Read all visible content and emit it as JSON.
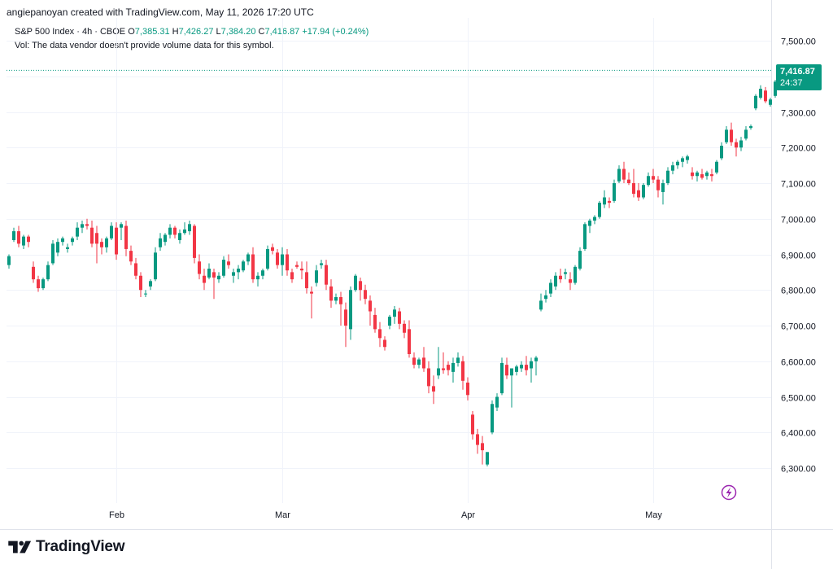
{
  "header": {
    "credit": "angiepanoyan created with TradingView.com, May 11, 2026 17:20 UTC",
    "symbol": "S&P 500 Index · 4h · CBOE",
    "open_label": "O",
    "open": "7,385.31",
    "high_label": "H",
    "high": "7,426.27",
    "low_label": "L",
    "low": "7,384.20",
    "close_label": "C",
    "close": "7,416.87",
    "change": "+17.94 (+0.24%)",
    "volume_note": "Vol: The data vendor doesn't provide volume data for this symbol."
  },
  "price_tag": {
    "price": "7,416.87",
    "countdown": "24:37"
  },
  "brand": {
    "name": "TradingView"
  },
  "icons": {
    "logo": "tradingview-logo-icon",
    "replay": "lightning-icon"
  },
  "colors": {
    "up": "#089981",
    "down": "#f23645",
    "grid": "#f0f3fa",
    "text": "#131722",
    "last_line": "#089981",
    "replay": "#9c27b0"
  },
  "chart_data": {
    "type": "candlestick",
    "title": "S&P 500 Index · 4h · CBOE",
    "ylim": [
      6200,
      7540
    ],
    "yticks": [
      6300,
      6400,
      6500,
      6600,
      6700,
      6800,
      6900,
      7000,
      7100,
      7200,
      7300,
      7400,
      7500
    ],
    "ytick_labels": [
      "6,300.00",
      "6,400.00",
      "6,500.00",
      "6,600.00",
      "6,700.00",
      "6,800.00",
      "6,900.00",
      "7,000.00",
      "7,100.00",
      "7,200.00",
      "7,300.00",
      "7,400.00",
      "7,500.00"
    ],
    "xticks": [
      {
        "label": "Feb",
        "index": 22
      },
      {
        "label": "Mar",
        "index": 56
      },
      {
        "label": "Apr",
        "index": 94
      },
      {
        "label": "May",
        "index": 132
      }
    ],
    "last_price": 7416.87,
    "grid": true,
    "candles": [
      [
        6870,
        6900,
        6860,
        6895
      ],
      [
        6940,
        6975,
        6935,
        6965
      ],
      [
        6965,
        6980,
        6920,
        6930
      ],
      [
        6925,
        6955,
        6915,
        6950
      ],
      [
        6950,
        6955,
        6920,
        6935
      ],
      [
        6865,
        6880,
        6820,
        6830
      ],
      [
        6830,
        6840,
        6795,
        6805
      ],
      [
        6805,
        6835,
        6800,
        6830
      ],
      [
        6830,
        6880,
        6825,
        6870
      ],
      [
        6875,
        6940,
        6870,
        6930
      ],
      [
        6905,
        6945,
        6895,
        6935
      ],
      [
        6935,
        6950,
        6925,
        6945
      ],
      [
        6915,
        6930,
        6905,
        6920
      ],
      [
        6935,
        6950,
        6925,
        6945
      ],
      [
        6950,
        6990,
        6940,
        6975
      ],
      [
        6975,
        6995,
        6960,
        6985
      ],
      [
        6985,
        7000,
        6970,
        6980
      ],
      [
        6975,
        6995,
        6920,
        6930
      ],
      [
        6960,
        6980,
        6875,
        6930
      ],
      [
        6935,
        6945,
        6900,
        6920
      ],
      [
        6920,
        6950,
        6905,
        6945
      ],
      [
        6945,
        6990,
        6940,
        6980
      ],
      [
        6975,
        6990,
        6885,
        6900
      ],
      [
        6975,
        6990,
        6940,
        6985
      ],
      [
        6980,
        6995,
        6895,
        6915
      ],
      [
        6910,
        6925,
        6870,
        6880
      ],
      [
        6875,
        6890,
        6830,
        6840
      ],
      [
        6840,
        6850,
        6780,
        6800
      ],
      [
        6790,
        6800,
        6780,
        6790
      ],
      [
        6810,
        6830,
        6800,
        6825
      ],
      [
        6830,
        6920,
        6825,
        6905
      ],
      [
        6920,
        6960,
        6910,
        6945
      ],
      [
        6935,
        6960,
        6925,
        6955
      ],
      [
        6955,
        6985,
        6945,
        6975
      ],
      [
        6975,
        6980,
        6945,
        6955
      ],
      [
        6940,
        6970,
        6930,
        6960
      ],
      [
        6960,
        6990,
        6955,
        6970
      ],
      [
        6965,
        6995,
        6955,
        6985
      ],
      [
        6980,
        6985,
        6875,
        6890
      ],
      [
        6880,
        6900,
        6830,
        6845
      ],
      [
        6840,
        6860,
        6800,
        6820
      ],
      [
        6835,
        6875,
        6830,
        6860
      ],
      [
        6850,
        6860,
        6775,
        6835
      ],
      [
        6830,
        6850,
        6820,
        6840
      ],
      [
        6840,
        6895,
        6835,
        6885
      ],
      [
        6880,
        6900,
        6860,
        6870
      ],
      [
        6840,
        6860,
        6820,
        6850
      ],
      [
        6850,
        6870,
        6830,
        6860
      ],
      [
        6855,
        6885,
        6850,
        6880
      ],
      [
        6880,
        6905,
        6870,
        6900
      ],
      [
        6900,
        6920,
        6820,
        6830
      ],
      [
        6830,
        6850,
        6810,
        6840
      ],
      [
        6840,
        6860,
        6830,
        6855
      ],
      [
        6860,
        6925,
        6855,
        6915
      ],
      [
        6920,
        6930,
        6900,
        6910
      ],
      [
        6905,
        6915,
        6860,
        6870
      ],
      [
        6870,
        6920,
        6840,
        6900
      ],
      [
        6900,
        6915,
        6840,
        6855
      ],
      [
        6850,
        6860,
        6820,
        6830
      ],
      [
        6870,
        6880,
        6860,
        6865
      ],
      [
        6860,
        6880,
        6830,
        6855
      ],
      [
        6850,
        6880,
        6790,
        6805
      ],
      [
        6795,
        6810,
        6720,
        6790
      ],
      [
        6820,
        6870,
        6810,
        6855
      ],
      [
        6870,
        6885,
        6860,
        6875
      ],
      [
        6870,
        6885,
        6800,
        6815
      ],
      [
        6810,
        6830,
        6750,
        6770
      ],
      [
        6770,
        6790,
        6760,
        6780
      ],
      [
        6780,
        6795,
        6700,
        6760
      ],
      [
        6745,
        6765,
        6640,
        6700
      ],
      [
        6690,
        6810,
        6660,
        6800
      ],
      [
        6800,
        6845,
        6795,
        6840
      ],
      [
        6825,
        6835,
        6770,
        6800
      ],
      [
        6800,
        6815,
        6760,
        6775
      ],
      [
        6770,
        6785,
        6700,
        6740
      ],
      [
        6730,
        6750,
        6680,
        6690
      ],
      [
        6690,
        6710,
        6640,
        6665
      ],
      [
        6660,
        6670,
        6630,
        6640
      ],
      [
        6700,
        6730,
        6690,
        6725
      ],
      [
        6725,
        6755,
        6705,
        6745
      ],
      [
        6740,
        6750,
        6690,
        6705
      ],
      [
        6705,
        6715,
        6665,
        6680
      ],
      [
        6690,
        6715,
        6610,
        6620
      ],
      [
        6610,
        6625,
        6580,
        6590
      ],
      [
        6590,
        6610,
        6580,
        6605
      ],
      [
        6610,
        6640,
        6570,
        6580
      ],
      [
        6580,
        6600,
        6510,
        6530
      ],
      [
        6530,
        6560,
        6480,
        6515
      ],
      [
        6560,
        6640,
        6550,
        6580
      ],
      [
        6580,
        6625,
        6565,
        6575
      ],
      [
        6590,
        6600,
        6560,
        6575
      ],
      [
        6570,
        6610,
        6540,
        6595
      ],
      [
        6595,
        6625,
        6585,
        6610
      ],
      [
        6600,
        6615,
        6520,
        6545
      ],
      [
        6540,
        6555,
        6490,
        6505
      ],
      [
        6450,
        6460,
        6380,
        6395
      ],
      [
        6395,
        6410,
        6340,
        6365
      ],
      [
        6370,
        6390,
        6310,
        6350
      ],
      [
        6310,
        6345,
        6305,
        6345
      ],
      [
        6400,
        6490,
        6395,
        6480
      ],
      [
        6470,
        6510,
        6460,
        6500
      ],
      [
        6510,
        6610,
        6505,
        6595
      ],
      [
        6590,
        6610,
        6550,
        6560
      ],
      [
        6560,
        6580,
        6470,
        6580
      ],
      [
        6570,
        6590,
        6560,
        6585
      ],
      [
        6580,
        6600,
        6570,
        6590
      ],
      [
        6590,
        6615,
        6560,
        6575
      ],
      [
        6580,
        6610,
        6540,
        6600
      ],
      [
        6600,
        6615,
        6560,
        6610
      ],
      [
        6745,
        6790,
        6740,
        6770
      ],
      [
        6775,
        6800,
        6765,
        6785
      ],
      [
        6790,
        6830,
        6780,
        6820
      ],
      [
        6810,
        6850,
        6800,
        6840
      ],
      [
        6840,
        6860,
        6820,
        6830
      ],
      [
        6845,
        6860,
        6830,
        6850
      ],
      [
        6830,
        6850,
        6800,
        6820
      ],
      [
        6820,
        6870,
        6815,
        6865
      ],
      [
        6860,
        6920,
        6855,
        6910
      ],
      [
        6915,
        6990,
        6910,
        6985
      ],
      [
        6980,
        7000,
        6960,
        6995
      ],
      [
        6995,
        7010,
        6985,
        7005
      ],
      [
        7005,
        7050,
        7000,
        7045
      ],
      [
        7040,
        7080,
        7030,
        7060
      ],
      [
        7050,
        7060,
        7030,
        7045
      ],
      [
        7050,
        7110,
        7045,
        7100
      ],
      [
        7105,
        7150,
        7100,
        7140
      ],
      [
        7140,
        7160,
        7100,
        7110
      ],
      [
        7110,
        7130,
        7095,
        7100
      ],
      [
        7100,
        7140,
        7060,
        7070
      ],
      [
        7080,
        7100,
        7050,
        7060
      ],
      [
        7060,
        7100,
        7055,
        7095
      ],
      [
        7095,
        7130,
        7090,
        7120
      ],
      [
        7120,
        7140,
        7100,
        7110
      ],
      [
        7110,
        7120,
        7060,
        7080
      ],
      [
        7075,
        7110,
        7040,
        7100
      ],
      [
        7100,
        7145,
        7095,
        7135
      ],
      [
        7135,
        7160,
        7125,
        7150
      ],
      [
        7150,
        7165,
        7140,
        7160
      ],
      [
        7160,
        7175,
        7145,
        7170
      ],
      [
        7165,
        7180,
        7155,
        7175
      ],
      [
        7130,
        7145,
        7110,
        7120
      ],
      [
        7120,
        7135,
        7105,
        7130
      ],
      [
        7125,
        7140,
        7110,
        7115
      ],
      [
        7120,
        7135,
        7110,
        7130
      ],
      [
        7125,
        7140,
        7105,
        7120
      ],
      [
        7130,
        7165,
        7125,
        7160
      ],
      [
        7170,
        7215,
        7165,
        7205
      ],
      [
        7215,
        7260,
        7210,
        7250
      ],
      [
        7250,
        7270,
        7205,
        7215
      ],
      [
        7215,
        7225,
        7175,
        7200
      ],
      [
        7200,
        7230,
        7190,
        7220
      ],
      [
        7225,
        7260,
        7220,
        7250
      ],
      [
        7255,
        7265,
        7250,
        7260
      ],
      [
        7310,
        7350,
        7305,
        7345
      ],
      [
        7340,
        7375,
        7335,
        7365
      ],
      [
        7360,
        7370,
        7325,
        7330
      ],
      [
        7320,
        7340,
        7315,
        7335
      ],
      [
        7345,
        7390,
        7340,
        7385
      ],
      [
        7385,
        7395,
        7375,
        7390
      ],
      [
        7385.31,
        7426.27,
        7384.2,
        7416.87
      ]
    ]
  }
}
